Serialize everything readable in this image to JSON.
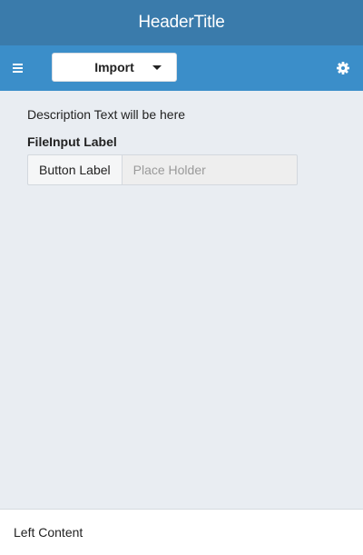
{
  "header": {
    "title": "HeaderTitle"
  },
  "toolbar": {
    "menu_icon": "hamburger-menu-icon",
    "import_label": "Import",
    "import_caret_icon": "caret-down-icon",
    "settings_icon": "gear-icon"
  },
  "main": {
    "description": "Description Text will be here",
    "file_input": {
      "label": "FileInput Label",
      "button_label": "Button Label",
      "placeholder": "Place Holder",
      "value": ""
    }
  },
  "footer": {
    "left_content": "Left Content"
  },
  "colors": {
    "header_bg": "#3a7bab",
    "toolbar_bg": "#3b8ec9",
    "page_bg": "#e9edf2",
    "footer_bg": "#ffffff"
  }
}
